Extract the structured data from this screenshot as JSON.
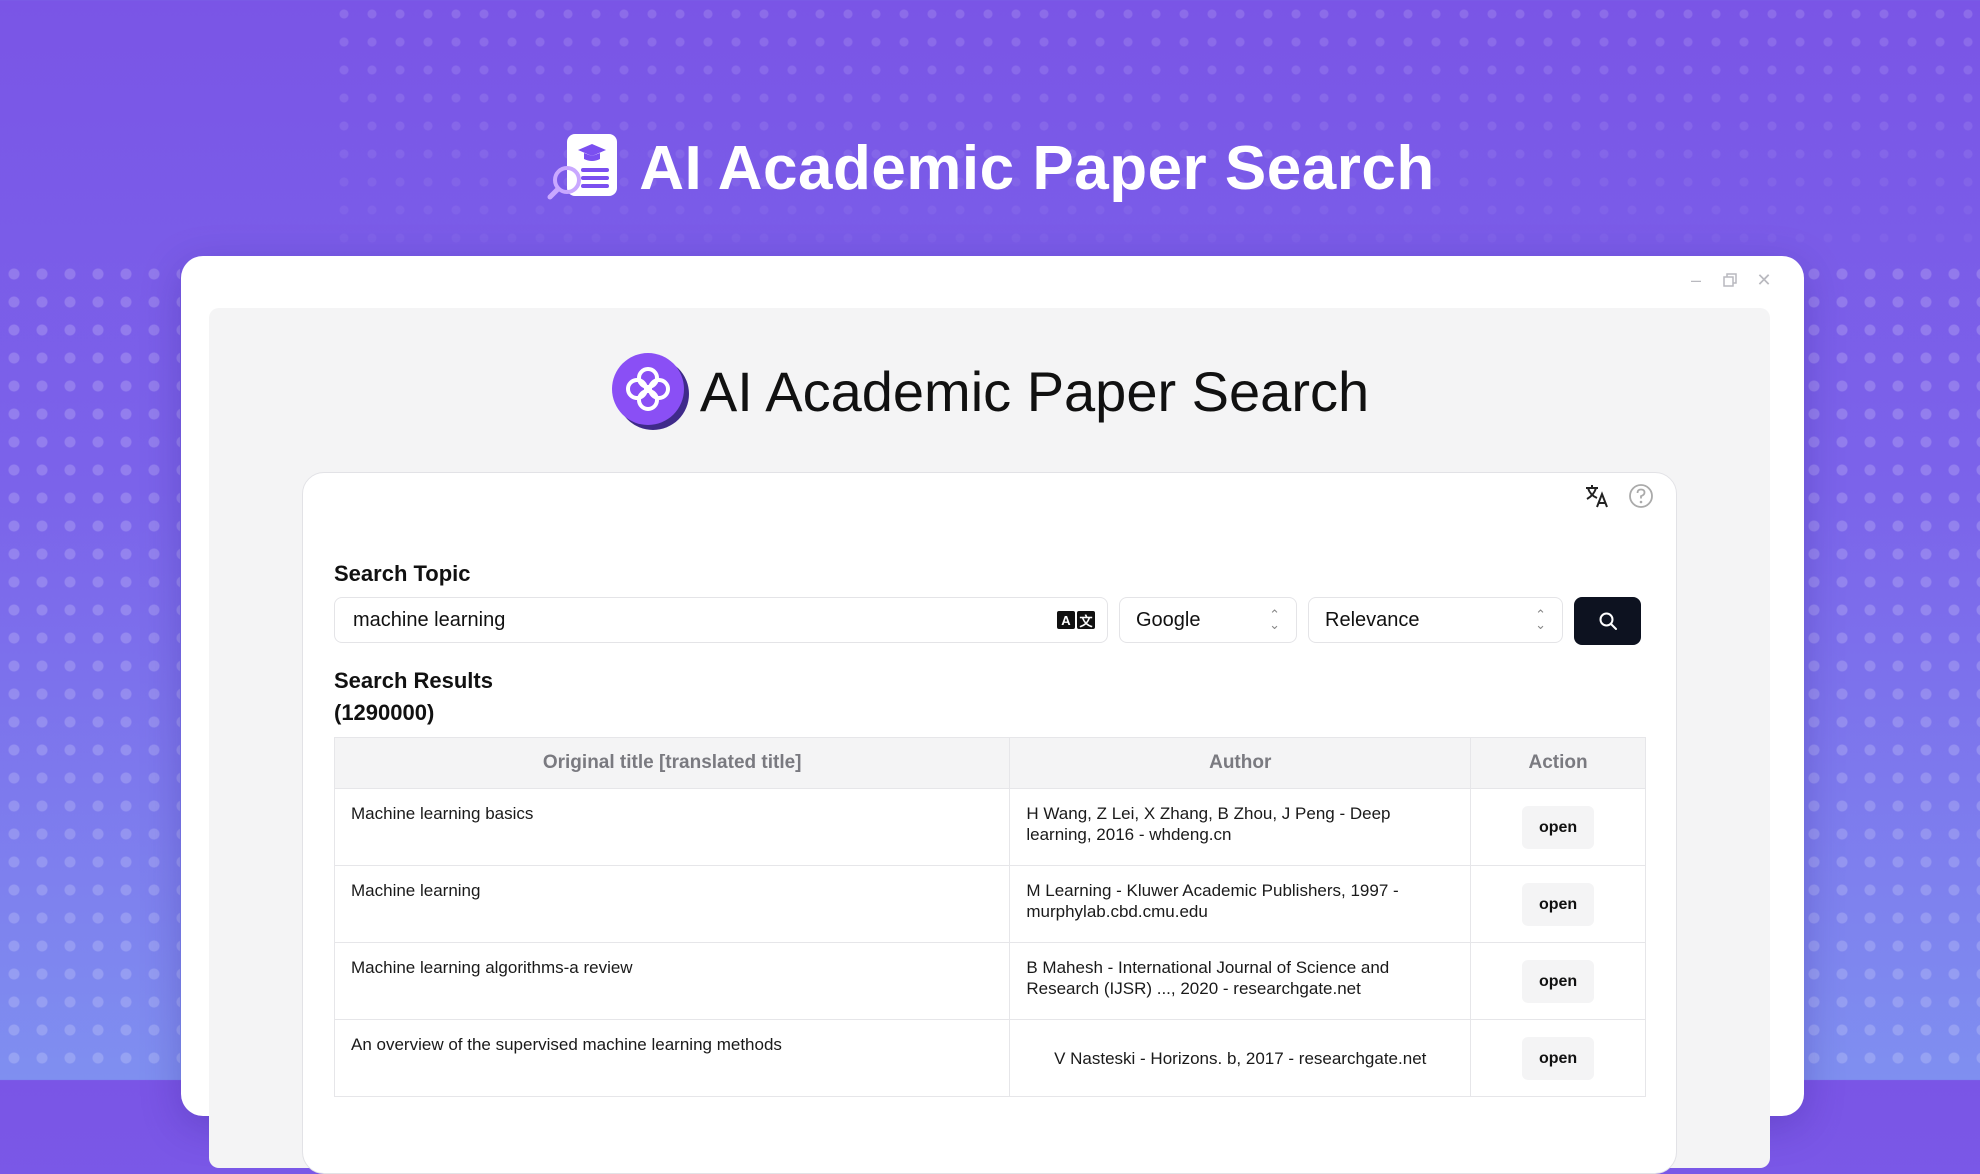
{
  "hero": {
    "title": "AI Academic Paper Search",
    "icon": "academic-paper-search-icon"
  },
  "window": {
    "controls": [
      "minimize-icon",
      "restore-icon",
      "close-icon"
    ]
  },
  "app": {
    "title": "AI Academic Paper Search",
    "logo": "clover-logo-icon",
    "tools": [
      "translate-icon",
      "help-icon"
    ]
  },
  "search": {
    "label": "Search Topic",
    "query": "machine learning",
    "translate_badge": [
      "A",
      "文"
    ],
    "engine": "Google",
    "sort": "Relevance"
  },
  "results": {
    "label": "Search Results",
    "count": "(1290000)",
    "columns": [
      "Original title [translated title]",
      "Author",
      "Action"
    ],
    "rows": [
      {
        "title": "Machine learning basics",
        "author": "H Wang, Z Lei, X Zhang, B Zhou, J Peng - Deep learning, 2016 - whdeng.cn",
        "action": "open"
      },
      {
        "title": "Machine learning",
        "author": "M Learning - Kluwer Academic Publishers, 1997 - murphylab.cbd.cmu.edu",
        "action": "open"
      },
      {
        "title": "Machine learning algorithms-a review",
        "author": "B Mahesh - International Journal of Science and Research (IJSR) ..., 2020 - researchgate.net",
        "action": "open"
      },
      {
        "title": "An overview of the supervised machine learning methods",
        "author": "V Nasteski - Horizons. b, 2017 - researchgate.net",
        "action": "open"
      }
    ]
  },
  "colors": {
    "accent": "#7b4ff0",
    "button_dark": "#0d1220"
  }
}
